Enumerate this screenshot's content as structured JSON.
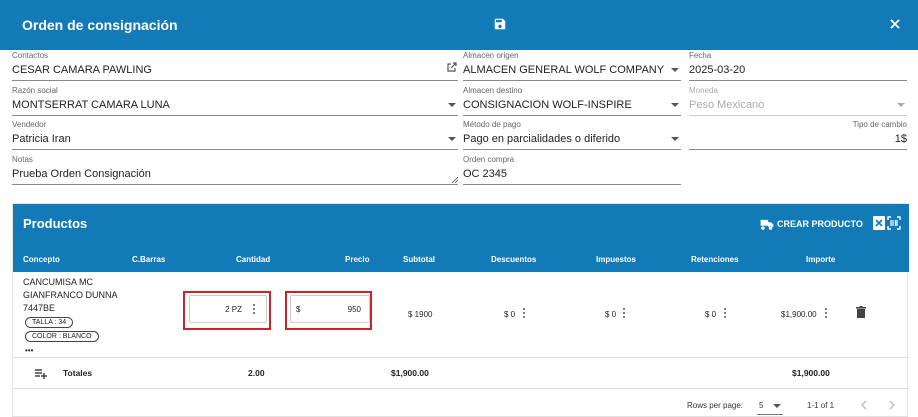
{
  "header": {
    "title": "Orden de consignación"
  },
  "form": {
    "contactos": {
      "label": "Contactos",
      "value": "CESAR CAMARA PAWLING"
    },
    "razon_social": {
      "label": "Razón social",
      "value": "MONTSERRAT CAMARA LUNA"
    },
    "vendedor": {
      "label": "Vendedor",
      "value": "Patricia Iran"
    },
    "notas": {
      "label": "Notas",
      "value": "Prueba Orden Consignación"
    },
    "almacen_origen": {
      "label": "Almacen origen",
      "value": "ALMACEN GENERAL WOLF COMPANY"
    },
    "almacen_destino": {
      "label": "Almacen destino",
      "value": "CONSIGNACION WOLF-INSPIRE"
    },
    "metodo_pago": {
      "label": "Método de pago",
      "value": "Pago en parcialidades o diferido"
    },
    "orden_compra": {
      "label": "Orden compra",
      "value": "OC 2345"
    },
    "fecha": {
      "label": "Fecha",
      "value": "2025-03-20"
    },
    "moneda": {
      "label": "Moneda",
      "value": "Peso Mexicano"
    },
    "tipo_cambio": {
      "label": "Tipo de cambio",
      "value": "1$"
    }
  },
  "products": {
    "title": "Productos",
    "create_label": "CREAR PRODUCTO",
    "columns": {
      "concepto": "Concepto",
      "barras": "C.Barras",
      "cantidad": "Cantidad",
      "precio": "Precio",
      "subtotal": "Subtotal",
      "descuentos": "Descuentos",
      "impuestos": "Impuestos",
      "retenciones": "Retenciones",
      "importe": "Importe"
    },
    "row": {
      "concept_lines": [
        "CANCUMISA MC",
        "GIANFRANCO DUNNA",
        "7447BE"
      ],
      "chips": [
        "TALLA : 34",
        "COLOR : BLANCO"
      ],
      "more": "•••",
      "quantity": "2 PZ",
      "currency": "$",
      "price": "950",
      "subtotal": "$ 1900",
      "descuentos": "$ 0",
      "impuestos": "$ 0",
      "retenciones": "$ 0",
      "importe": "$1,900.00"
    },
    "totals": {
      "label": "Totales",
      "cantidad": "2.00",
      "subtotal": "$1,900.00",
      "importe": "$1,900.00"
    },
    "pagination": {
      "rows_label": "Rows per page:",
      "rows_value": "5",
      "range": "1-1 of 1"
    }
  }
}
